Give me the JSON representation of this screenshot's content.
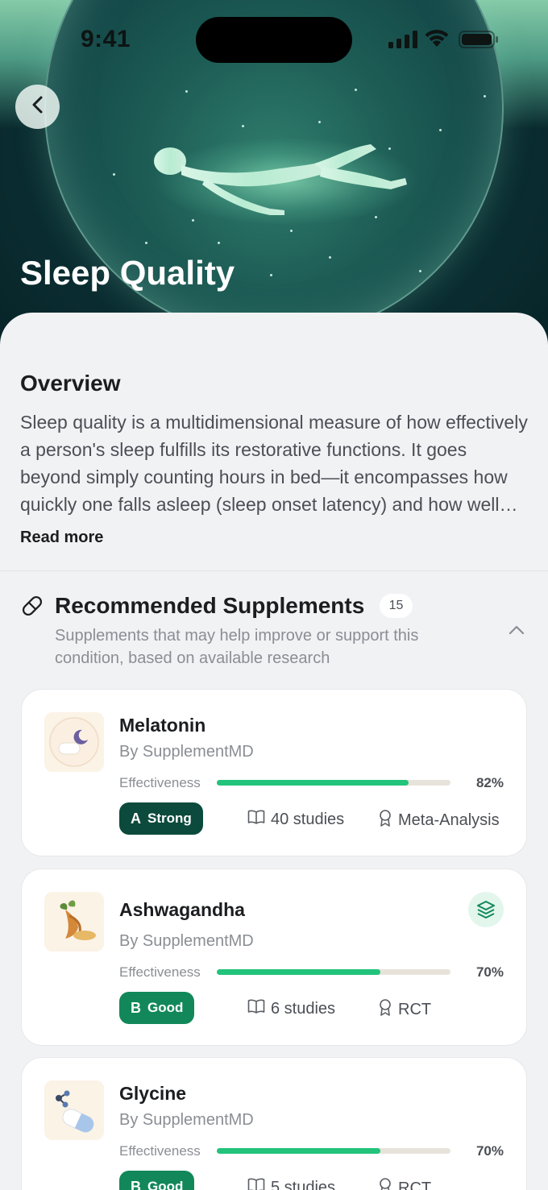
{
  "status_bar": {
    "time": "9:41"
  },
  "hero": {
    "title": "Sleep Quality"
  },
  "overview": {
    "title": "Overview",
    "text": "Sleep quality is a multidimensional measure of how effectively a person's sleep fulfills its restorative functions. It goes beyond simply counting hours in bed—it encompasses how quickly one falls asleep (sleep onset latency) and how well one stays asleep.",
    "read_more": "Read more"
  },
  "recommended": {
    "title": "Recommended Supplements",
    "count": "15",
    "subtitle": "Supplements that may help improve or support this condition, based on available research"
  },
  "supplements": [
    {
      "name": "Melatonin",
      "by": "By SupplementMD",
      "effectiveness_label": "Effectiveness",
      "effectiveness": 82,
      "pct": "82%",
      "grade_letter": "A",
      "grade_word": "Strong",
      "studies": "40 studies",
      "evidence": "Meta-Analysis",
      "icon": "moon-pill-icon"
    },
    {
      "name": "Ashwagandha",
      "by": "By SupplementMD",
      "effectiveness_label": "Effectiveness",
      "effectiveness": 70,
      "pct": "70%",
      "grade_letter": "B",
      "grade_word": "Good",
      "studies": "6 studies",
      "evidence": "RCT",
      "icon": "root-herb-icon",
      "layers_badge": "layers-icon"
    },
    {
      "name": "Glycine",
      "by": "By SupplementMD",
      "effectiveness_label": "Effectiveness",
      "effectiveness": 70,
      "pct": "70%",
      "grade_letter": "B",
      "grade_word": "Good",
      "studies": "5 studies",
      "evidence": "RCT",
      "icon": "molecule-capsule-icon"
    }
  ],
  "colors": {
    "accent_green": "#22c37b",
    "grade_strong": "#0b4a3c",
    "grade_good": "#12885a"
  }
}
